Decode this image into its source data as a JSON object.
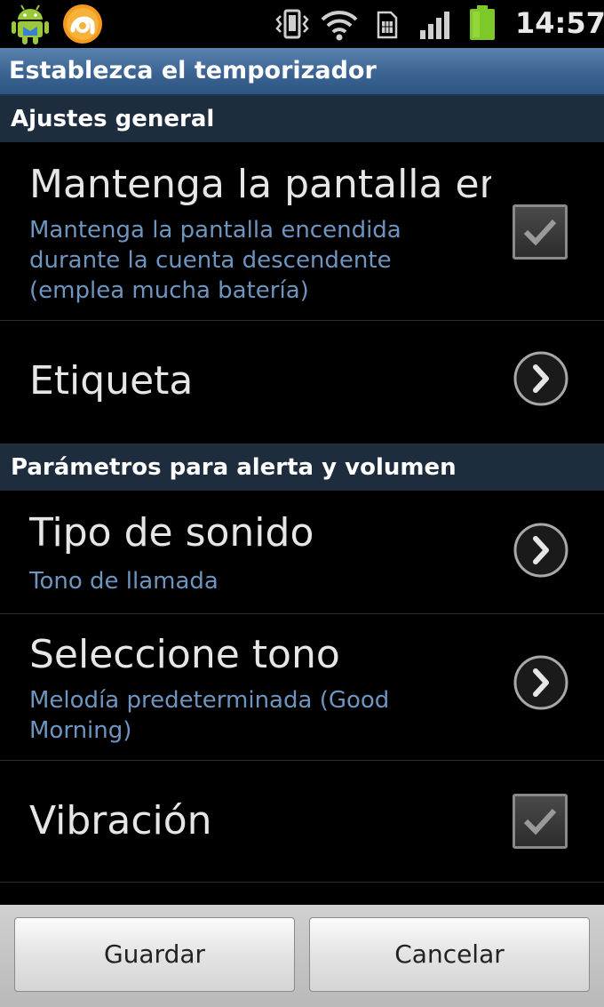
{
  "status_bar": {
    "time": "14:57",
    "icons": [
      "android-notification-icon",
      "app-notification-icon",
      "vibrate-icon",
      "wifi-icon",
      "sim-card-icon",
      "signal-bars-icon",
      "battery-icon"
    ]
  },
  "title_bar": {
    "title": "Establezca el temporizador"
  },
  "sections": [
    {
      "header": "Ajustes general",
      "rows": [
        {
          "title": "Mantenga la pantalla encendida",
          "summary": "Mantenga la pantalla encendida durante la cuenta descendente (emplea mucha batería)",
          "control": "checkbox",
          "checked": true
        },
        {
          "title": "Etiqueta",
          "summary": "",
          "control": "chevron"
        }
      ]
    },
    {
      "header": "Parámetros para alerta y volumen",
      "rows": [
        {
          "title": "Tipo de sonido",
          "summary": "Tono de llamada",
          "control": "chevron"
        },
        {
          "title": "Seleccione tono",
          "summary": "Melodía predeterminada (Good Morning)",
          "control": "chevron"
        },
        {
          "title": "Vibración",
          "summary": "",
          "control": "checkbox",
          "checked": true
        }
      ]
    }
  ],
  "buttons": {
    "save_label": "Guardar",
    "cancel_label": "Cancelar"
  },
  "colors": {
    "title_bar": "#3b6492",
    "section_header": "#1e2d3d",
    "summary_text": "#6d95bf",
    "battery": "#7ec82a"
  }
}
